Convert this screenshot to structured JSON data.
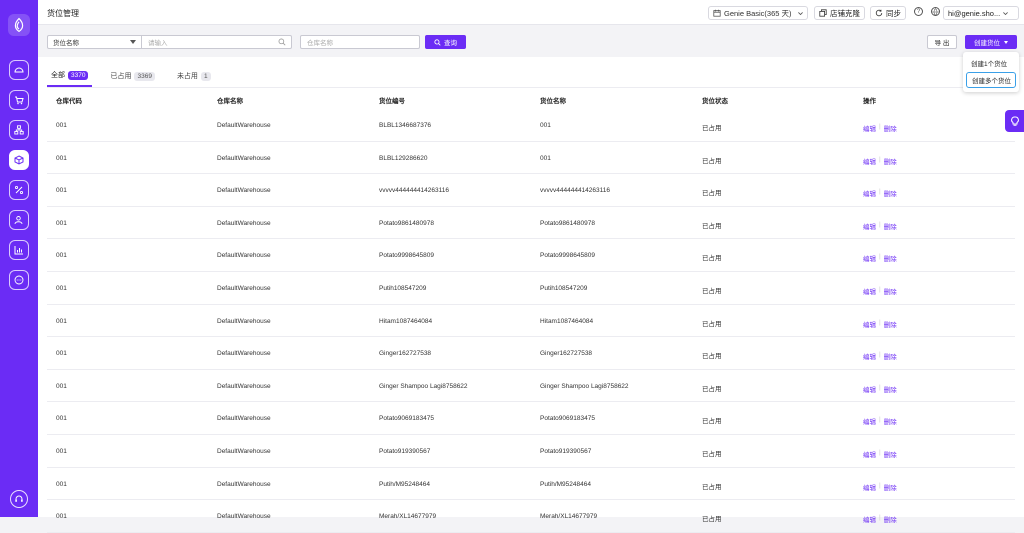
{
  "header": {
    "title": "货位管理",
    "plan_label": "Genie Basic(365 天)",
    "clone_label": "店铺克隆",
    "sync_label": "同步",
    "account": "hi@genie.sho..."
  },
  "sidebar": {
    "items": [
      {
        "icon": "dashboard-icon"
      },
      {
        "icon": "cart-icon"
      },
      {
        "icon": "org-chart-icon"
      },
      {
        "icon": "box-icon",
        "active": true
      },
      {
        "icon": "percent-icon"
      },
      {
        "icon": "users-icon"
      },
      {
        "icon": "bar-chart-icon"
      },
      {
        "icon": "chat-icon"
      }
    ],
    "support_icon": "headset-icon"
  },
  "filters": {
    "field_select": "货位名称",
    "keyword_placeholder": "请输入",
    "warehouse_placeholder": "仓库名称",
    "query_label": "查询",
    "export_label": "导 出",
    "create_label": "创建货位"
  },
  "dropdown": {
    "items": [
      "创建1个货位",
      "创建多个货位"
    ]
  },
  "tabs": [
    {
      "label": "全部",
      "count": "3370"
    },
    {
      "label": "已占用",
      "count": "3369"
    },
    {
      "label": "未占用",
      "count": "1"
    }
  ],
  "table": {
    "columns": [
      "仓库代码",
      "仓库名称",
      "货位编号",
      "货位名称",
      "货位状态",
      "操作"
    ],
    "edit_label": "编辑",
    "delete_label": "删除",
    "sep": "|",
    "rows": [
      [
        "001",
        "DefaultWarehouse",
        "BLBL1346687376",
        "001",
        "已占用"
      ],
      [
        "001",
        "DefaultWarehouse",
        "BLBL129286620",
        "001",
        "已占用"
      ],
      [
        "001",
        "DefaultWarehouse",
        "vvvvv444444414263116",
        "vvvvv444444414263116",
        "已占用"
      ],
      [
        "001",
        "DefaultWarehouse",
        "Potato9861480978",
        "Potato9861480978",
        "已占用"
      ],
      [
        "001",
        "DefaultWarehouse",
        "Potato9998645809",
        "Potato9998645809",
        "已占用"
      ],
      [
        "001",
        "DefaultWarehouse",
        "Putih108547209",
        "Putih108547209",
        "已占用"
      ],
      [
        "001",
        "DefaultWarehouse",
        "Hitam1087464084",
        "Hitam1087464084",
        "已占用"
      ],
      [
        "001",
        "DefaultWarehouse",
        "Ginger162727538",
        "Ginger162727538",
        "已占用"
      ],
      [
        "001",
        "DefaultWarehouse",
        "Ginger Shampoo Lagi8758622",
        "Ginger Shampoo Lagi8758622",
        "已占用"
      ],
      [
        "001",
        "DefaultWarehouse",
        "Potato9069183475",
        "Potato9069183475",
        "已占用"
      ],
      [
        "001",
        "DefaultWarehouse",
        "Potato919390567",
        "Potato919390567",
        "已占用"
      ],
      [
        "001",
        "DefaultWarehouse",
        "Putih/M95248464",
        "Putih/M95248464",
        "已占用"
      ],
      [
        "001",
        "DefaultWarehouse",
        "Merah/XL14677979",
        "Merah/XL14677979",
        "已占用"
      ]
    ]
  },
  "colors": {
    "accent": "#6b2cf5",
    "focus": "#3aa0e8"
  }
}
